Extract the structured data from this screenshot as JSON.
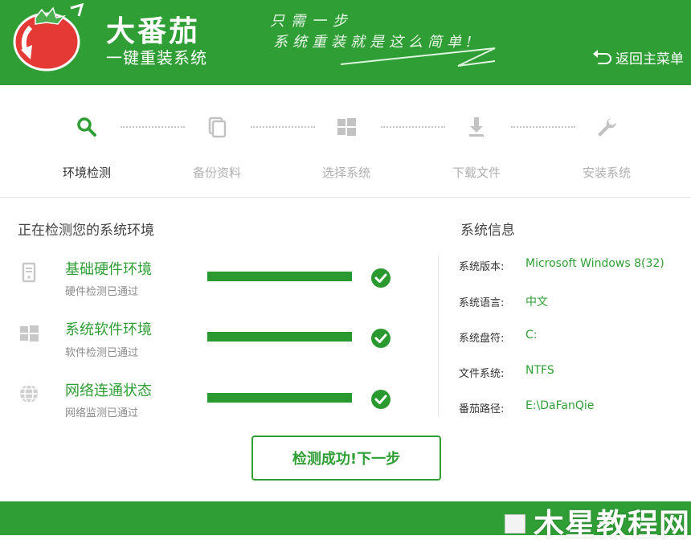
{
  "header": {
    "brand_title": "大番茄",
    "brand_subtitle": "一键重装系统",
    "slogan_line1": "只需一步",
    "slogan_line2": "系统重装就是这么简单!",
    "back_label": "返回主菜单"
  },
  "steps": [
    {
      "label": "环境检测",
      "icon": "search-icon",
      "active": true
    },
    {
      "label": "备份资料",
      "icon": "copy-icon",
      "active": false
    },
    {
      "label": "选择系统",
      "icon": "windows-icon",
      "active": false
    },
    {
      "label": "下载文件",
      "icon": "download-icon",
      "active": false
    },
    {
      "label": "安装系统",
      "icon": "wrench-icon",
      "active": false
    }
  ],
  "detect": {
    "title": "正在检测您的系统环境",
    "items": [
      {
        "title": "基础硬件环境",
        "status": "硬件检测已通过",
        "progress": 1.0,
        "icon": "hardware-icon"
      },
      {
        "title": "系统软件环境",
        "status": "软件检测已通过",
        "progress": 1.0,
        "icon": "windows-icon"
      },
      {
        "title": "网络连通状态",
        "status": "网络监测已通过",
        "progress": 1.0,
        "icon": "globe-icon"
      }
    ]
  },
  "sysinfo": {
    "title": "系统信息",
    "rows": [
      {
        "key": "系统版本:",
        "value": "Microsoft Windows 8(32)"
      },
      {
        "key": "系统语言:",
        "value": "中文"
      },
      {
        "key": "系统盘符:",
        "value": "C:"
      },
      {
        "key": "文件系统:",
        "value": "NTFS"
      },
      {
        "key": "番茄路径:",
        "value": "E:\\DaFanQie"
      }
    ]
  },
  "next_button": "检测成功!下一步",
  "watermark": "木星教程网",
  "colors": {
    "brand_green": "#2f9e35",
    "inactive_gray": "#b0b0b0"
  }
}
